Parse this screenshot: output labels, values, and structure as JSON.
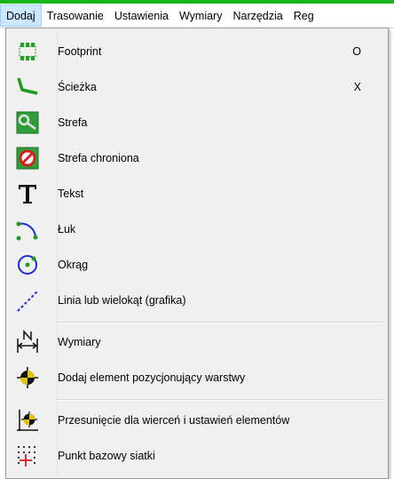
{
  "menubar": {
    "items": [
      "Dodaj",
      "Trasowanie",
      "Ustawienia",
      "Wymiary",
      "Narzędzia",
      "Reg"
    ]
  },
  "menu": {
    "items": [
      {
        "label": "Footprint",
        "shortcut": "O",
        "icon": "footprint-icon"
      },
      {
        "label": "Ścieżka",
        "shortcut": "X",
        "icon": "track-icon"
      },
      {
        "label": "Strefa",
        "shortcut": "",
        "icon": "zone-icon"
      },
      {
        "label": "Strefa chroniona",
        "shortcut": "",
        "icon": "keepout-zone-icon"
      },
      {
        "label": "Tekst",
        "shortcut": "",
        "icon": "text-icon"
      },
      {
        "label": "Łuk",
        "shortcut": "",
        "icon": "arc-icon"
      },
      {
        "label": "Okrąg",
        "shortcut": "",
        "icon": "circle-icon"
      },
      {
        "label": "Linia lub wielokąt (grafika)",
        "shortcut": "",
        "icon": "line-icon"
      },
      {
        "label": "Wymiary",
        "shortcut": "",
        "icon": "dimension-icon"
      },
      {
        "label": "Dodaj element pozycjonujący warstwy",
        "shortcut": "",
        "icon": "layer-alignment-target-icon"
      },
      {
        "label": "Przesunięcie dla wierceń i ustawień elementów",
        "shortcut": "",
        "icon": "drill-origin-icon"
      },
      {
        "label": "Punkt bazowy siatki",
        "shortcut": "",
        "icon": "grid-origin-icon"
      }
    ]
  },
  "colors": {
    "accent_green": "#18b418",
    "menu_highlight": "#cce8ff",
    "icon_blue": "#1e2ad8",
    "icon_red": "#d42020"
  }
}
